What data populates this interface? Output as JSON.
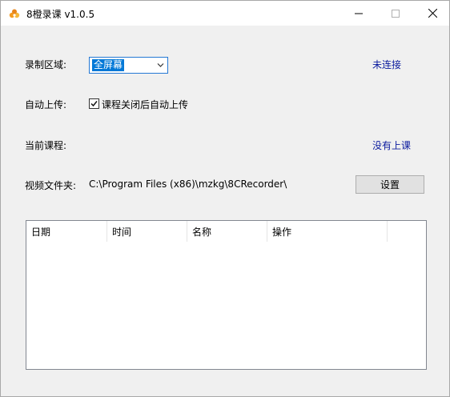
{
  "window": {
    "title": "8橙录课 v1.0.5"
  },
  "form": {
    "record_area_label": "录制区域:",
    "record_area_value": "全屏幕",
    "connection_status": "未连接",
    "auto_upload_label": "自动上传:",
    "auto_upload_checkbox_label": "课程关闭后自动上传",
    "auto_upload_checked": true,
    "current_course_label": "当前课程:",
    "current_course_status": "没有上课",
    "video_folder_label": "视频文件夹:",
    "video_folder_path": "C:\\Program Files (x86)\\mzkg\\8CRecorder\\",
    "settings_button": "设置"
  },
  "table": {
    "columns": [
      "日期",
      "时间",
      "名称",
      "操作"
    ],
    "rows": []
  },
  "colors": {
    "link": "#0a1a9e",
    "selection": "#0078d7",
    "window_bg": "#f0f0f0"
  }
}
